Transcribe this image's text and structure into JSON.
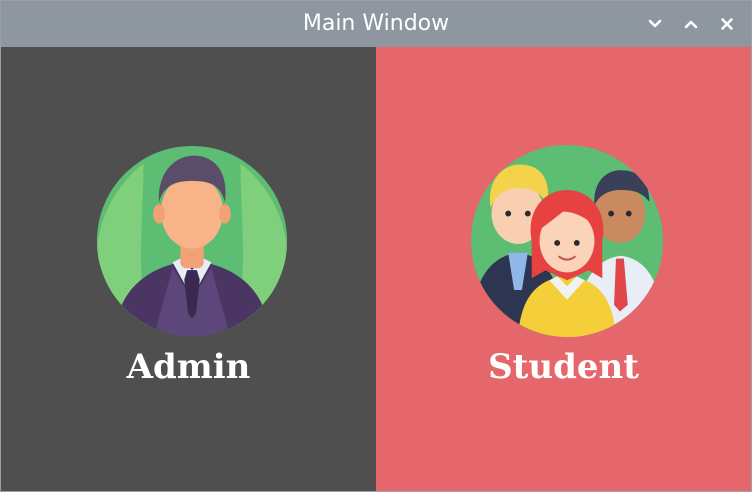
{
  "window": {
    "title": "Main Window",
    "controls": [
      "minimize",
      "maximize",
      "close"
    ]
  },
  "panels": {
    "admin": {
      "label": "Admin",
      "background": "#4f4f4f",
      "icon": "admin-avatar-icon"
    },
    "student": {
      "label": "Student",
      "background": "#e5666b",
      "icon": "students-group-icon"
    }
  },
  "colors": {
    "titlebar": "#8e96a0",
    "text": "#ffffff",
    "avatar_bg": "#5dbd72"
  }
}
